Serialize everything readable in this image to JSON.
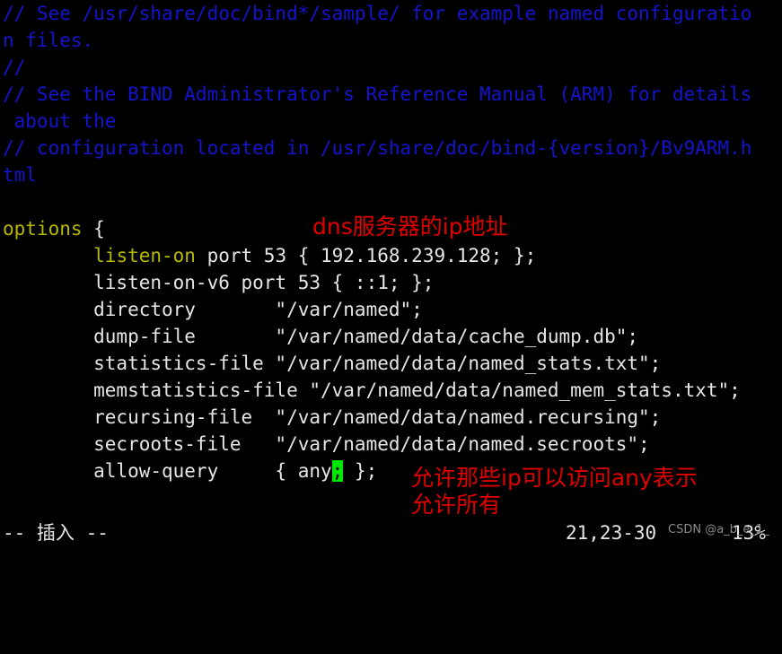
{
  "terminal": {
    "background": "#000000",
    "foreground": "#d8d8d8",
    "comment_color": "#1414cd",
    "keyword_color": "#b8b800",
    "cursor_color": "#00e800",
    "annotation_color": "#e00000"
  },
  "editor": {
    "lines": [
      {
        "id": "l1",
        "kind": "comment",
        "text": "// See /usr/share/doc/bind*/sample/ for example named configuratio"
      },
      {
        "id": "l2",
        "kind": "comment",
        "text": "n files."
      },
      {
        "id": "l3",
        "kind": "comment",
        "text": "//"
      },
      {
        "id": "l4",
        "kind": "comment",
        "text": "// See the BIND Administrator's Reference Manual (ARM) for details"
      },
      {
        "id": "l5",
        "kind": "comment",
        "text": " about the"
      },
      {
        "id": "l6",
        "kind": "comment",
        "text": "// configuration located in /usr/share/doc/bind-{version}/Bv9ARM.h"
      },
      {
        "id": "l7",
        "kind": "comment",
        "text": "tml"
      },
      {
        "id": "l8",
        "kind": "blank",
        "text": ""
      },
      {
        "id": "l9",
        "kind": "options_open",
        "keyword": "options",
        "rest": " {"
      },
      {
        "id": "l10",
        "kind": "kwline",
        "indent": "        ",
        "keyword": "listen-on",
        "rest": " port 53 { 192.168.239.128; };"
      },
      {
        "id": "l11",
        "kind": "plain",
        "text": "        listen-on-v6 port 53 { ::1; };"
      },
      {
        "id": "l12",
        "kind": "plain",
        "text": "        directory       \"/var/named\";"
      },
      {
        "id": "l13",
        "kind": "plain",
        "text": "        dump-file       \"/var/named/data/cache_dump.db\";"
      },
      {
        "id": "l14",
        "kind": "plain",
        "text": "        statistics-file \"/var/named/data/named_stats.txt\";"
      },
      {
        "id": "l15",
        "kind": "plain",
        "text": "        memstatistics-file \"/var/named/data/named_mem_stats.txt\";"
      },
      {
        "id": "l16",
        "kind": "plain",
        "text": "        recursing-file  \"/var/named/data/named.recursing\";"
      },
      {
        "id": "l17",
        "kind": "plain",
        "text": "        secroots-file   \"/var/named/data/named.secroots\";"
      },
      {
        "id": "l18",
        "kind": "cursorline",
        "before": "        allow-query     { any",
        "cursor": ";",
        "after": " };"
      }
    ]
  },
  "status": {
    "mode": "-- 插入 --",
    "position": "21,23-30",
    "percent": "13%"
  },
  "annotations": {
    "ip_note": "dns服务器的ip地址",
    "allow_note_line1": "允许那些ip可以访问any表示",
    "allow_note_line2": "允许所有"
  },
  "watermark": {
    "text": "CSDN @a_b_e_1_"
  }
}
